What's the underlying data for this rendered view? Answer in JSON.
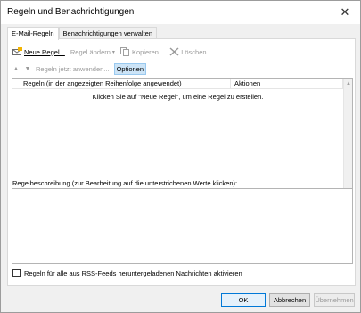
{
  "dialog": {
    "title": "Regeln und Benachrichtigungen",
    "close_glyph": "✕"
  },
  "tabs": [
    {
      "label": "E-Mail-Regeln",
      "active": true
    },
    {
      "label": "Benachrichtigungen verwalten",
      "active": false
    }
  ],
  "toolbar": {
    "new_rule": "Neue Regel...",
    "change_rule": "Regel ändern",
    "copy": "Kopieren...",
    "delete": "Löschen",
    "run_rules": "Regeln jetzt anwenden...",
    "options": "Optionen"
  },
  "rules_list": {
    "columns": [
      "Regeln (in der angezeigten Reihenfolge angewendet)",
      "Aktionen"
    ],
    "empty_message": "Klicken Sie auf \"Neue Regel\", um eine Regel zu erstellen."
  },
  "description": {
    "label": "Regelbeschreibung (zur Bearbeitung auf die unterstrichenen Werte klicken):"
  },
  "rss": {
    "label": "Regeln für alle aus RSS-Feeds heruntergeladenen Nachrichten aktivieren",
    "checked": false
  },
  "buttons": {
    "ok": "OK",
    "cancel": "Abbrechen",
    "apply": "Übernehmen"
  }
}
